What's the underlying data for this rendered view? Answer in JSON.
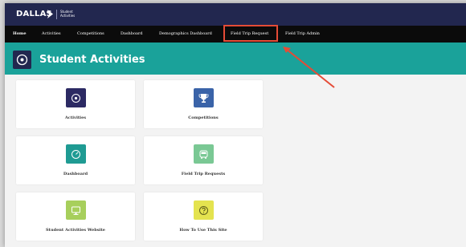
{
  "brand": {
    "logo_text": "DALLAS",
    "subtitle_line1": "Student",
    "subtitle_line2": "Activities"
  },
  "nav": {
    "items": [
      {
        "label": "Home"
      },
      {
        "label": "Activities"
      },
      {
        "label": "Competitions"
      },
      {
        "label": "Dashboard"
      },
      {
        "label": "Demographics Dashboard"
      },
      {
        "label": "Field Trip Request"
      },
      {
        "label": "Field Trip Admin"
      }
    ]
  },
  "page": {
    "title": "Student Activities"
  },
  "cards": [
    {
      "label": "Activities",
      "icon": "info-icon",
      "color": "#2c2a63"
    },
    {
      "label": "Competitions",
      "icon": "trophy-icon",
      "color": "#3a63a8"
    },
    {
      "label": "Dashboard",
      "icon": "gauge-icon",
      "color": "#1f9b93"
    },
    {
      "label": "Field Trip Requests",
      "icon": "bus-icon",
      "color": "#7ac894"
    },
    {
      "label": "Student Activities Website",
      "icon": "monitor-icon",
      "color": "#a7cf5c"
    },
    {
      "label": "How To Use This Site",
      "icon": "question-icon",
      "color": "#e4e34f"
    }
  ],
  "colors": {
    "brand_navy": "#22274f",
    "nav_black": "#0b0b0b",
    "teal_banner": "#1aa29a",
    "highlight_red": "#e54b36"
  }
}
